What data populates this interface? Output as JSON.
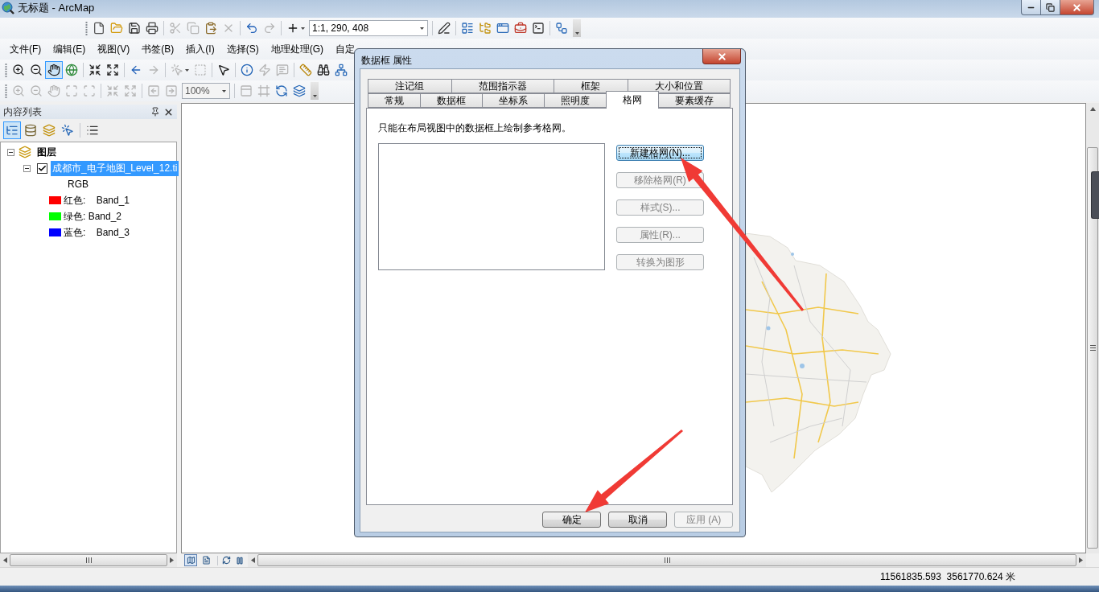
{
  "window": {
    "title": "无标题 - ArcMap"
  },
  "standard_toolbar": {
    "groups": [
      [
        {
          "kind": "new",
          "disabled": false
        },
        {
          "kind": "open",
          "disabled": false
        },
        {
          "kind": "save",
          "disabled": false
        },
        {
          "kind": "print",
          "disabled": false
        }
      ],
      [
        {
          "kind": "cut",
          "disabled": true
        },
        {
          "kind": "copy",
          "disabled": true
        },
        {
          "kind": "paste",
          "disabled": false
        },
        {
          "kind": "delete",
          "disabled": true
        }
      ],
      [
        {
          "kind": "undo",
          "disabled": false
        },
        {
          "kind": "redo",
          "disabled": true
        }
      ],
      [
        {
          "kind": "add-data",
          "disabled": false
        },
        {
          "kind": "scale",
          "value": "1:1, 290, 408",
          "disabled": false
        }
      ],
      [
        {
          "kind": "editor",
          "disabled": false
        }
      ],
      [
        {
          "kind": "toc-window",
          "disabled": false
        },
        {
          "kind": "catalog-window",
          "disabled": false
        },
        {
          "kind": "search-window",
          "disabled": false
        },
        {
          "kind": "toolbox",
          "disabled": false
        },
        {
          "kind": "python",
          "disabled": false
        }
      ],
      [
        {
          "kind": "model-builder",
          "disabled": false
        }
      ]
    ]
  },
  "menu_bar": [
    "文件(F)",
    "编辑(E)",
    "视图(V)",
    "书签(B)",
    "插入(I)",
    "选择(S)",
    "地理处理(G)",
    "自定"
  ],
  "tools_toolbar": {
    "groups": [
      [
        {
          "kind": "zoom-in",
          "disabled": false,
          "selected": false
        },
        {
          "kind": "zoom-out",
          "disabled": false,
          "selected": false
        },
        {
          "kind": "pan",
          "disabled": false,
          "selected": true
        },
        {
          "kind": "full-extent",
          "disabled": false,
          "selected": false
        }
      ],
      [
        {
          "kind": "fixed-zoom-in",
          "disabled": false,
          "selected": false
        },
        {
          "kind": "fixed-zoom-out",
          "disabled": false,
          "selected": false
        }
      ],
      [
        {
          "kind": "back",
          "disabled": false,
          "selected": false
        },
        {
          "kind": "forward",
          "disabled": true,
          "selected": false
        }
      ],
      [
        {
          "kind": "select-features",
          "disabled": true,
          "selected": false
        },
        {
          "kind": "clear-selection",
          "disabled": true,
          "selected": false
        }
      ],
      [
        {
          "kind": "select-elements",
          "disabled": false,
          "selected": false
        }
      ],
      [
        {
          "kind": "identify",
          "disabled": false,
          "selected": false
        },
        {
          "kind": "hyperlink",
          "disabled": true,
          "selected": false
        },
        {
          "kind": "html-popup",
          "disabled": true,
          "selected": false
        }
      ],
      [
        {
          "kind": "measure",
          "disabled": false,
          "selected": false
        },
        {
          "kind": "find",
          "disabled": false,
          "selected": false
        },
        {
          "kind": "go-to-xy",
          "disabled": false,
          "selected": false
        }
      ]
    ]
  },
  "layout_toolbar": {
    "groups": [
      [
        {
          "kind": "zoom-in-page",
          "disabled": true
        },
        {
          "kind": "zoom-out-page",
          "disabled": true
        },
        {
          "kind": "pan-page",
          "disabled": true
        },
        {
          "kind": "zoom-whole-page",
          "disabled": true
        },
        {
          "kind": "zoom-100",
          "disabled": true
        }
      ],
      [
        {
          "kind": "fixed-zoom-in-page",
          "disabled": true
        },
        {
          "kind": "fixed-zoom-out-page",
          "disabled": true
        }
      ],
      [
        {
          "kind": "previous-extent",
          "disabled": true
        },
        {
          "kind": "next-extent",
          "disabled": true
        },
        {
          "kind": "zoom-percent",
          "value": "100%",
          "disabled": true
        }
      ],
      [
        {
          "kind": "toggle-draft",
          "disabled": true
        },
        {
          "kind": "focus-frame",
          "disabled": true
        },
        {
          "kind": "change-layout",
          "disabled": false
        },
        {
          "kind": "data-driven-pages",
          "disabled": false
        }
      ]
    ]
  },
  "contents_panel": {
    "title": "内容列表",
    "view_tabs": [
      {
        "kind": "drawing-order",
        "selected": true
      },
      {
        "kind": "source",
        "selected": false
      },
      {
        "kind": "visibility",
        "selected": false
      },
      {
        "kind": "selection",
        "selected": false
      }
    ],
    "tree": [
      {
        "kind": "data-frame",
        "label": "图层",
        "expanded": true,
        "selected": false,
        "children": [
          {
            "kind": "layer",
            "label": "成都市_电子地图_Level_12.ti",
            "expanded": true,
            "checked": true,
            "selected": true,
            "children": [
              {
                "kind": "renderer",
                "label": "RGB"
              },
              {
                "kind": "band",
                "label": "红色:    Band_1",
                "color": "#ff0000"
              },
              {
                "kind": "band",
                "label": "绿色: Band_2",
                "color": "#00ff00"
              },
              {
                "kind": "band",
                "label": "蓝色:    Band_3",
                "color": "#0000ff"
              }
            ]
          }
        ]
      }
    ]
  },
  "map_view": {
    "view_buttons": [
      {
        "kind": "data-view",
        "selected": true
      },
      {
        "kind": "layout-view",
        "selected": false
      }
    ]
  },
  "dialog": {
    "title": "数据框 属性",
    "tab_rows": [
      [
        {
          "label": "注记组",
          "selected": false
        },
        {
          "label": "范围指示器",
          "selected": false
        },
        {
          "label": "框架",
          "selected": false
        },
        {
          "label": "大小和位置",
          "selected": false
        }
      ],
      [
        {
          "label": "常规",
          "selected": false
        },
        {
          "label": "数据框",
          "selected": false
        },
        {
          "label": "坐标系",
          "selected": false
        },
        {
          "label": "照明度",
          "selected": false
        },
        {
          "label": "格网",
          "selected": true
        },
        {
          "label": "要素缓存",
          "selected": false
        }
      ]
    ],
    "note": "只能在布局视图中的数据框上绘制参考格网。",
    "side_buttons": [
      {
        "label": "新建格网(N)...",
        "disabled": false,
        "focused": true
      },
      {
        "label": "移除格网(R)",
        "disabled": true,
        "focused": false
      },
      {
        "label": "样式(S)...",
        "disabled": true,
        "focused": false
      },
      {
        "label": "属性(R)...",
        "disabled": true,
        "focused": false
      },
      {
        "label": "转换为图形",
        "disabled": true,
        "focused": false
      }
    ],
    "buttons": [
      {
        "label": "确定",
        "disabled": false
      },
      {
        "label": "取消",
        "disabled": false
      },
      {
        "label": "应用 (A)",
        "disabled": true
      }
    ]
  },
  "status_bar": {
    "coordinates": "11561835.593  3561770.624 米"
  }
}
